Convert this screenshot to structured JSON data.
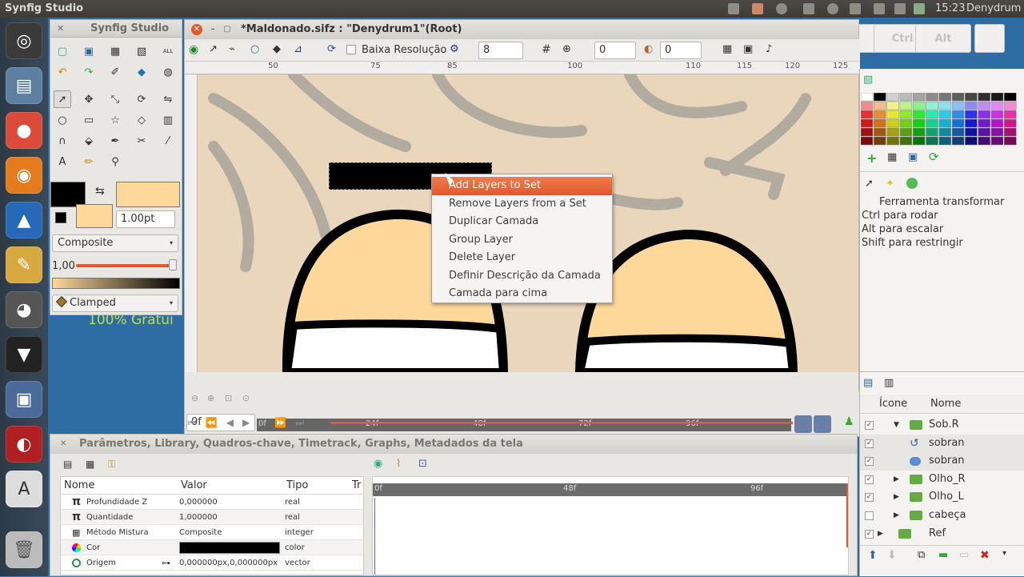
{
  "topbar": {
    "title": "Synfig Studio",
    "clock": "15:23",
    "user": "Denydrum"
  },
  "desktop": {
    "promo_text": "100% Gratui"
  },
  "toolbox": {
    "title": "Synfig Studio",
    "width_value": "1.00pt",
    "blend_method": "Composite",
    "amount": "1,00",
    "interpolation": "Clamped"
  },
  "canvas": {
    "title": "*Maldonado.sifz : \"Denydrum1\"(Root)",
    "low_res_label": "Baixa Resolução",
    "quality_value": "8",
    "frame_value_1": "0",
    "frame_value_2": "0",
    "ruler_ticks": [
      "50",
      "75",
      "85",
      "100",
      "110",
      "115",
      "120",
      "125"
    ]
  },
  "context_menu": {
    "items": [
      "Add Layers to Set",
      "Remove Layers from a Set",
      "Duplicar Camada",
      "Group Layer",
      "Delete Layer",
      "Definir Descrição da Camada",
      "Camada para cima"
    ],
    "highlighted_index": 0
  },
  "timebar": {
    "current_time": "0f",
    "ticks": [
      "0f",
      "24f",
      "48f",
      "72f",
      "96f"
    ]
  },
  "keys": {
    "key1": "Ctrl",
    "key2": "Alt"
  },
  "tool_options": {
    "title": "Ferramenta transformar",
    "lines": [
      "Ctrl para rodar",
      "Alt para escalar",
      "Shift para restringir"
    ]
  },
  "layers": {
    "col_icon": "Ícone",
    "col_name": "Nome",
    "rows": [
      {
        "name": "Sob.R",
        "checked": true,
        "kind": "group",
        "expanded": true
      },
      {
        "name": "sobran",
        "checked": true,
        "kind": "curve"
      },
      {
        "name": "sobran",
        "checked": true,
        "kind": "region"
      },
      {
        "name": "Olho_R",
        "checked": true,
        "kind": "group"
      },
      {
        "name": "Olho_L",
        "checked": true,
        "kind": "group"
      },
      {
        "name": "cabeça",
        "checked": false,
        "kind": "group"
      },
      {
        "name": "Ref",
        "checked": true,
        "kind": "group"
      }
    ]
  },
  "params": {
    "title": "Parâmetros, Library, Quadros-chave, Timetrack, Graphs, Metadados da tela",
    "headers": [
      "Nome",
      "Valor",
      "Tipo",
      "Tr"
    ],
    "rows": [
      {
        "name": "Profundidade Z",
        "value": "0,000000",
        "type": "real",
        "icon": "pi-icon"
      },
      {
        "name": "Quantidade",
        "value": "1,000000",
        "type": "real",
        "icon": "pi-icon"
      },
      {
        "name": "Método Mistura",
        "value": "Composite",
        "type": "integer",
        "icon": "blend-icon"
      },
      {
        "name": "Cor",
        "value": "",
        "type": "color",
        "icon": "color-icon"
      },
      {
        "name": "Origem",
        "value": "0,000000px,0,000000px",
        "type": "vector",
        "icon": "origin-icon"
      }
    ],
    "track_ticks": [
      "0f",
      "48f",
      "96f"
    ]
  },
  "colors": {
    "accent": "#e2592d",
    "fill": "#fdd89a",
    "outline": "#000000"
  }
}
